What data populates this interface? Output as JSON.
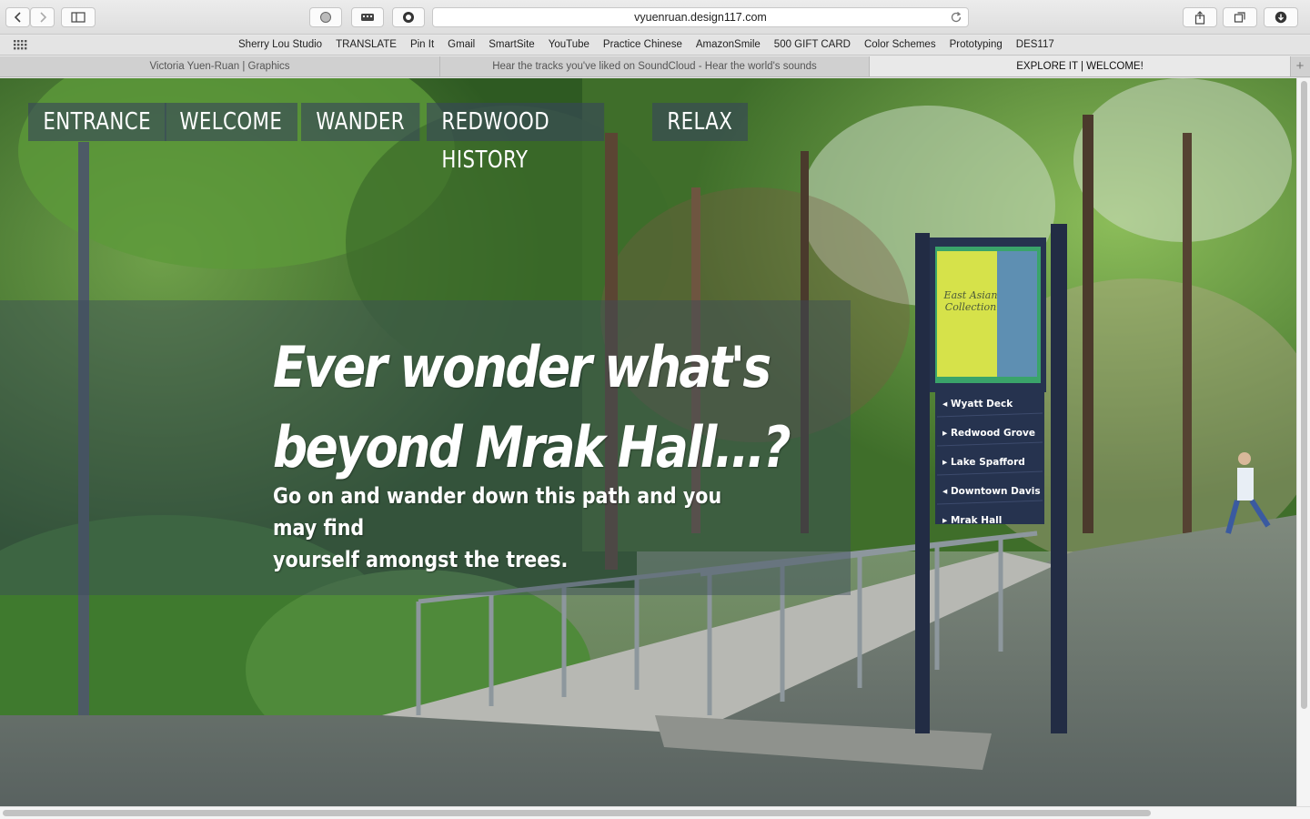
{
  "browser": {
    "url": "vyuenruan.design117.com",
    "bookmarks": [
      "Sherry Lou Studio",
      "TRANSLATE",
      "Pin It",
      "Gmail",
      "SmartSite",
      "YouTube",
      "Practice Chinese",
      "AmazonSmile",
      "500 GIFT CARD",
      "Color Schemes",
      "Prototyping",
      "DES117"
    ],
    "tabs": [
      {
        "title": "Victoria Yuen-Ruan | Graphics",
        "active": false
      },
      {
        "title": "Hear the tracks you've liked on SoundCloud - Hear the world's sounds",
        "active": false
      },
      {
        "title": "EXPLORE IT | WELCOME!",
        "active": true
      }
    ],
    "icons": {
      "back": "chevron-left-icon",
      "forward": "chevron-right-icon",
      "sidebar": "sidebar-icon",
      "share": "share-icon",
      "tabs_overview": "tabs-overview-icon",
      "downloads": "download-icon",
      "reload": "reload-icon",
      "new_tab": "plus-icon"
    }
  },
  "page": {
    "nav": [
      "ENTRANCE",
      "WELCOME",
      "WANDER",
      "REDWOOD HISTORY",
      "RELAX"
    ],
    "hero": {
      "title_line1": "Ever wonder what's",
      "title_line2": "beyond Mrak Hall...?",
      "subtitle_line1": "Go on and wander down this path and you may find",
      "subtitle_line2": "yourself amongst the trees."
    },
    "sign": {
      "header_line1": "East Asian",
      "header_line2": "Collection",
      "directions": [
        "Wyatt Deck",
        "Redwood Grove",
        "Lake Spafford",
        "Downtown Davis",
        "Mrak Hall"
      ]
    }
  },
  "colors": {
    "nav_bg": "#37465a",
    "hero_overlay": "#3c4b5c",
    "sign_board": "#26334f",
    "sign_panel": "#d6e24a"
  }
}
